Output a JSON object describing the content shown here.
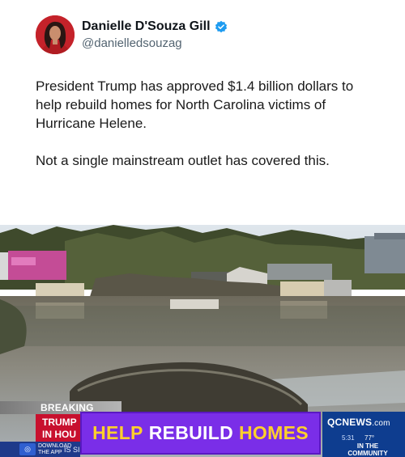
{
  "post": {
    "author": {
      "display_name": "Danielle D'Souza Gill",
      "handle": "@danielledsouzag",
      "verified_icon": "verified-badge-icon",
      "verified_color": "#1d9bf0"
    },
    "paragraphs": [
      "President Trump has approved $1.4 billion dollars to help rebuild homes for North Carolina victims of Hurricane Helene.",
      "Not a single mainstream outlet has covered this."
    ]
  },
  "broadcast": {
    "breaking_label": "BREAKING NEWS",
    "story_line1": "TRUMP",
    "story_line2": "IN HOU",
    "banner_word1": "HELP",
    "banner_word2": "REBUILD",
    "banner_word3": "HOMES",
    "app_line1": "DOWNLOAD",
    "app_line2": "THE APP",
    "ticker_fragment": "IS SI",
    "station_name": "QCNEWS",
    "station_suffix": ".com",
    "time": "5:31",
    "temperature": "77°",
    "tagline_line1": "IN THE",
    "tagline_line2": "COMMUNITY",
    "colors": {
      "banner_bg": "#7a2ee8",
      "banner_yellow": "#ffd02b",
      "story_red": "#c8102e",
      "station_blue": "#0e3d8f"
    }
  }
}
